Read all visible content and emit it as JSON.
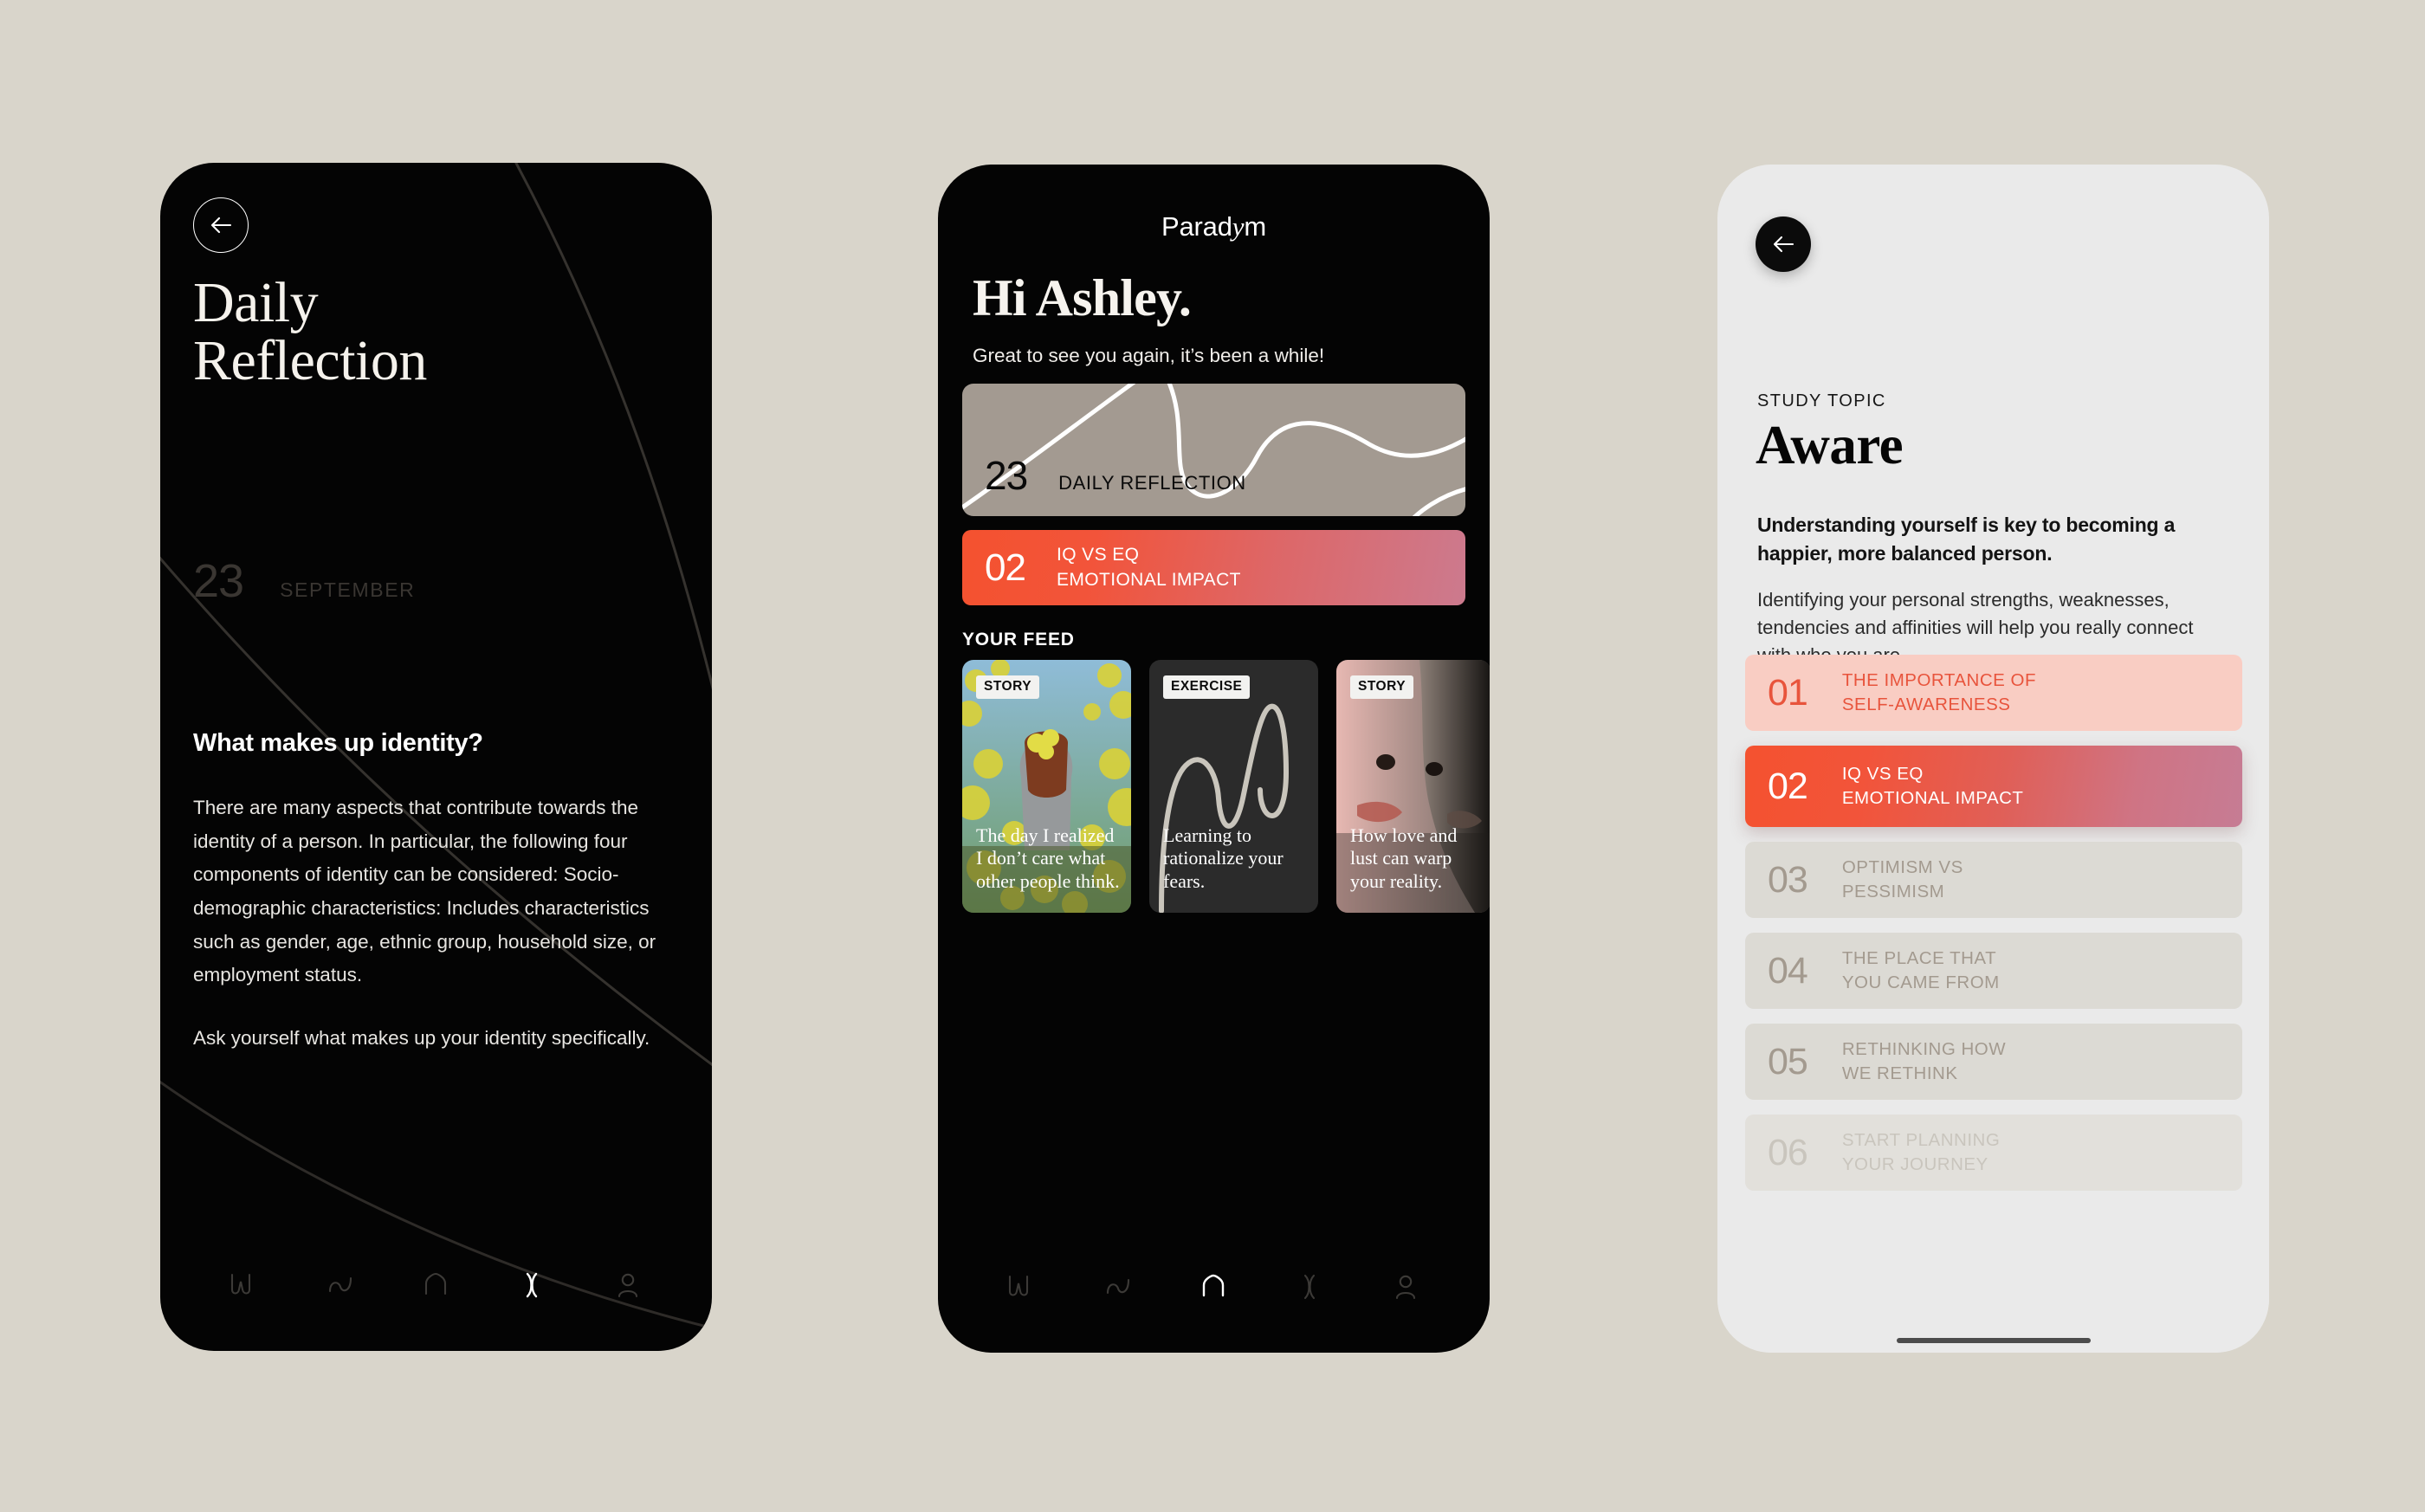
{
  "palette": {
    "canvas": "#d9d5cb",
    "phone_dark": "#040404",
    "phone_light": "#eaeaea",
    "accent_orange": "#f4522f",
    "accent_pink": "#cc7a8e",
    "accent_red_text": "#e8543c",
    "pale_pink": "#f9cdc3",
    "warm_gray_card": "#a39a91",
    "muted_gray_text": "#a39a8f"
  },
  "phone1": {
    "back_icon": "arrow-left-icon",
    "title_line1": "Daily",
    "title_line2": "Reflection",
    "date_day": "23",
    "date_month": "SEPTEMBER",
    "question": "What makes up identity?",
    "body_paragraph_1": "There are many aspects that contribute towards the identity of a person. In particular, the following four components of identity can be considered: Socio-demographic characteristics: Includes characteristics such as gender, age, ethnic group, household size, or employment status.",
    "body_paragraph_2": "Ask yourself what makes up your identity specifically.",
    "nav": [
      {
        "name": "nav-w-icon",
        "active": false
      },
      {
        "name": "nav-wave-icon",
        "active": false
      },
      {
        "name": "nav-home-icon",
        "active": false
      },
      {
        "name": "nav-lens-icon",
        "active": true
      },
      {
        "name": "nav-profile-icon",
        "active": false
      }
    ]
  },
  "phone2": {
    "logo_text": "Parad",
    "logo_y": "y",
    "logo_tail": "m",
    "greeting": "Hi Ashley.",
    "subtitle": "Great to see you again, it’s been a while!",
    "reflection_card": {
      "day": "23",
      "label": "DAILY REFLECTION"
    },
    "lesson_card": {
      "number": "02",
      "line1": "IQ VS EQ",
      "line2": "EMOTIONAL IMPACT"
    },
    "feed_label": "YOUR FEED",
    "feed": [
      {
        "tag": "STORY",
        "title": "The day I realized I don’t care what other people think.",
        "art": "woman-in-yellow-flowers-photo"
      },
      {
        "tag": "EXERCISE",
        "title": "Learning to rationalize your fears.",
        "art": "abstract-line-squiggle-graphic"
      },
      {
        "tag": "STORY",
        "title": "How love and lust can warp your reality.",
        "art": "two-faces-close-up-photo"
      }
    ],
    "nav": [
      {
        "name": "nav-w-icon",
        "active": false
      },
      {
        "name": "nav-wave-icon",
        "active": false
      },
      {
        "name": "nav-home-icon",
        "active": true
      },
      {
        "name": "nav-lens-icon",
        "active": false
      },
      {
        "name": "nav-profile-icon",
        "active": false
      }
    ]
  },
  "phone3": {
    "back_icon": "arrow-left-icon",
    "eyebrow": "STUDY TOPIC",
    "title": "Aware",
    "lead": "Understanding yourself is key to becoming a happier, more balanced person.",
    "description": "Identifying your personal strengths, weaknesses, tendencies and affinities will help you really connect with who you are.",
    "topics": [
      {
        "number": "01",
        "line1": "THE IMPORTANCE OF",
        "line2": "SELF-AWARENESS",
        "state": "completed"
      },
      {
        "number": "02",
        "line1": "IQ VS EQ",
        "line2": "EMOTIONAL IMPACT",
        "state": "active"
      },
      {
        "number": "03",
        "line1": "OPTIMISM VS",
        "line2": "PESSIMISM",
        "state": "locked"
      },
      {
        "number": "04",
        "line1": "THE PLACE THAT",
        "line2": "YOU CAME FROM",
        "state": "locked"
      },
      {
        "number": "05",
        "line1": "RETHINKING HOW",
        "line2": "WE RETHINK",
        "state": "locked"
      },
      {
        "number": "06",
        "line1": "START PLANNING",
        "line2": "YOUR JOURNEY",
        "state": "faded"
      }
    ]
  }
}
